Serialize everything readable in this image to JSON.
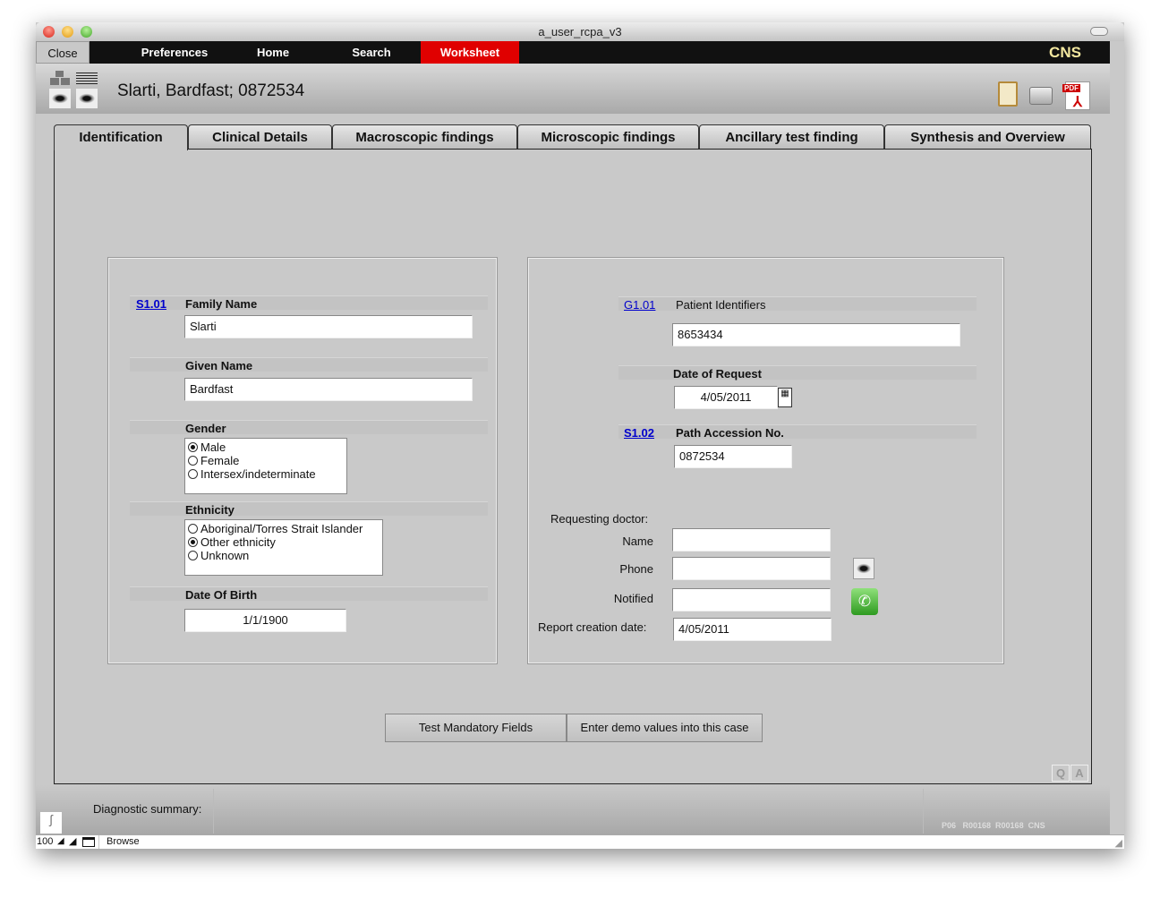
{
  "window": {
    "title": "a_user_rcpa_v3"
  },
  "nav": {
    "close": "Close",
    "items": [
      "Preferences",
      "Home",
      "Search",
      "Worksheet"
    ],
    "active": "Worksheet",
    "active_color": "#e00000",
    "brand": "CNS"
  },
  "header": {
    "patient": "Slarti, Bardfast; 0872534",
    "icons": [
      "org-eye-icon",
      "list-eye-icon",
      "clipboard-icon",
      "printer-icon",
      "pdf-icon"
    ]
  },
  "tabs": [
    "Identification",
    "Clinical Details",
    "Macroscopic findings",
    "Microscopic findings",
    "Ancillary test finding",
    "Synthesis and Overview"
  ],
  "active_tab": "Identification",
  "left": {
    "code": "S1.01",
    "family_label": "Family Name",
    "family_value": "Slarti",
    "given_label": "Given Name",
    "given_value": "Bardfast",
    "gender_label": "Gender",
    "gender_options": [
      "Male",
      "Female",
      "Intersex/indeterminate"
    ],
    "gender_selected": "Male",
    "ethnicity_label": "Ethnicity",
    "ethnicity_options": [
      "Aboriginal/Torres Strait Islander",
      "Other ethnicity",
      "Unknown"
    ],
    "ethnicity_selected": "Other ethnicity",
    "dob_label": "Date Of Birth",
    "dob_value": "1/1/1900"
  },
  "right": {
    "g_code": "G1.01",
    "patient_ids_label": "Patient Identifiers",
    "patient_ids_value": "8653434",
    "request_label": "Date of Request",
    "request_value": "4/05/2011",
    "s_code": "S1.02",
    "accession_label": "Path Accession No.",
    "accession_value": "0872534",
    "doctor_label": "Requesting doctor:",
    "name_label": "Name",
    "name_value": "",
    "phone_label": "Phone",
    "phone_value": "",
    "notified_label": "Notified",
    "notified_value": "",
    "report_label": "Report creation date:",
    "report_value": "4/05/2011"
  },
  "buttons": {
    "test": "Test Mandatory Fields",
    "demo": "Enter demo values into this case",
    "q": "Q",
    "a": "A"
  },
  "footer": {
    "diag_label": "Diagnostic summary:",
    "diag_value": "",
    "codes": "P06   R00168  R00168  CNS"
  },
  "status": {
    "zoom": "100",
    "mode": "Browse"
  }
}
